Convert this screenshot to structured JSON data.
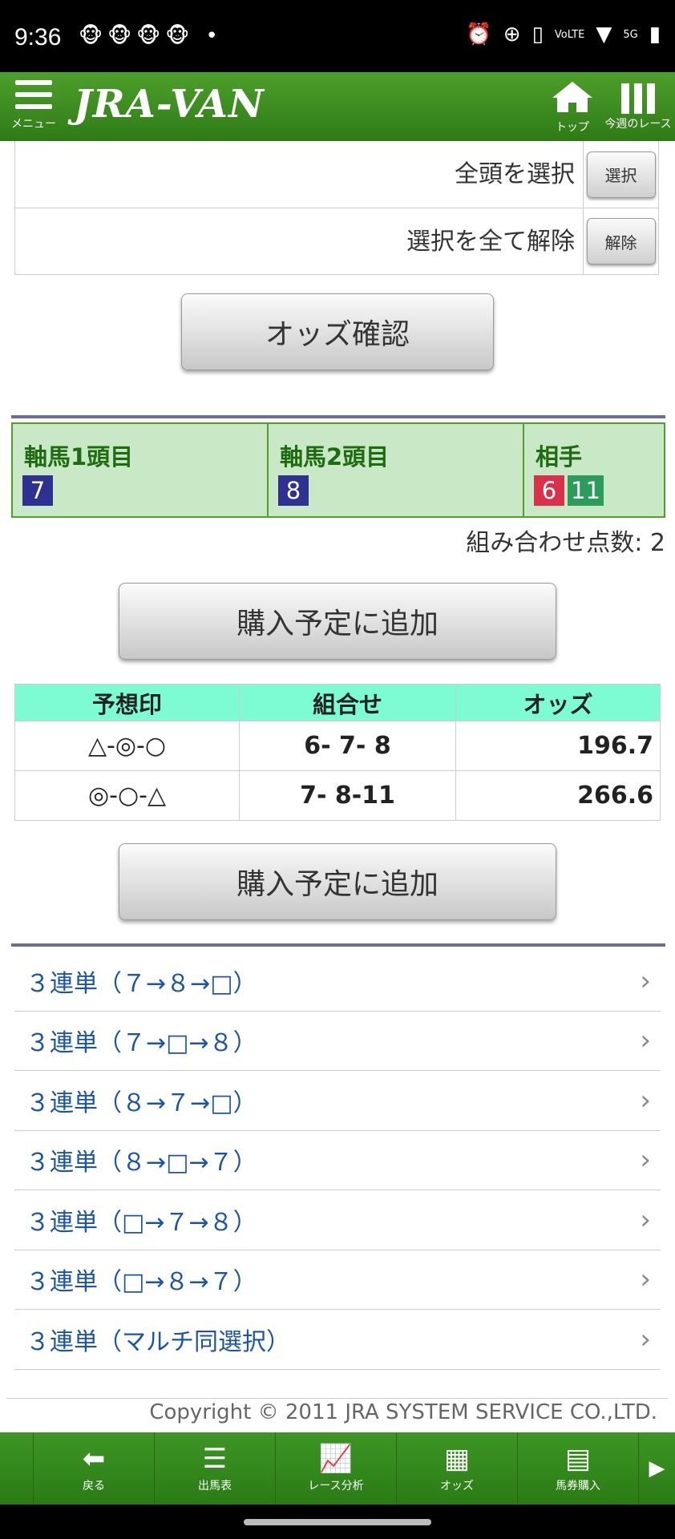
{
  "status_bar": {
    "time": "9:36",
    "notifications": "🐵🐵🐵🐵 •",
    "icons": [
      "alarm-icon",
      "data-saver-icon",
      "vibrate-icon",
      "volte-icon",
      "wifi-icon",
      "5g-signal-icon",
      "battery-icon"
    ],
    "volte_label": "VoLTE",
    "network_label": "5G"
  },
  "header": {
    "menu_label": "メニュー",
    "logo": "JRA-VAN",
    "home_label": "トップ",
    "week_label": "今週のレース"
  },
  "select_rows": [
    {
      "label": "全頭を選択",
      "button": "選択"
    },
    {
      "label": "選択を全て解除",
      "button": "解除"
    }
  ],
  "odds_confirm_button": "オッズ確認",
  "summary": {
    "axis1_title": "軸馬1頭目",
    "axis2_title": "軸馬2頭目",
    "partner_title": "相手",
    "axis1_numbers": [
      "7"
    ],
    "axis2_numbers": [
      "8"
    ],
    "partner_numbers": [
      "6",
      "11"
    ],
    "colors": {
      "7": "#2e3192",
      "8": "#2e3192",
      "6": "#d9304b",
      "11": "#2b9c5a"
    }
  },
  "combo_count": "組み合わせ点数: 2",
  "add_button": "購入予定に追加",
  "odds_table": {
    "headers": [
      "予想印",
      "組合せ",
      "オッズ"
    ],
    "rows": [
      {
        "mark": "△-◎-○",
        "combo": "6- 7- 8",
        "odds": "196.7"
      },
      {
        "mark": "◎-○-△",
        "combo": "7- 8-11",
        "odds": "266.6"
      }
    ]
  },
  "links": [
    "３連単（７→８→□）",
    "３連単（７→□→８）",
    "３連単（８→７→□）",
    "３連単（８→□→７）",
    "３連単（□→７→８）",
    "３連単（□→８→７）",
    "３連単（マルチ同選択）"
  ],
  "copyright": "Copyright © 2011 JRA SYSTEM SERVICE CO.,LTD.",
  "bottom_nav": [
    {
      "icon": "back-arrow-icon",
      "label": "戻る"
    },
    {
      "icon": "list-icon",
      "label": "出馬表"
    },
    {
      "icon": "chart-icon",
      "label": "レース分析"
    },
    {
      "icon": "odds-grid-icon",
      "label": "オッズ"
    },
    {
      "icon": "ticket-icon",
      "label": "馬券購入"
    }
  ],
  "theme": {
    "brand_green": "#3d9625",
    "link_blue": "#1b55a8",
    "table_header": "#7dfbd2",
    "summary_bg": "#c8e8c6"
  }
}
